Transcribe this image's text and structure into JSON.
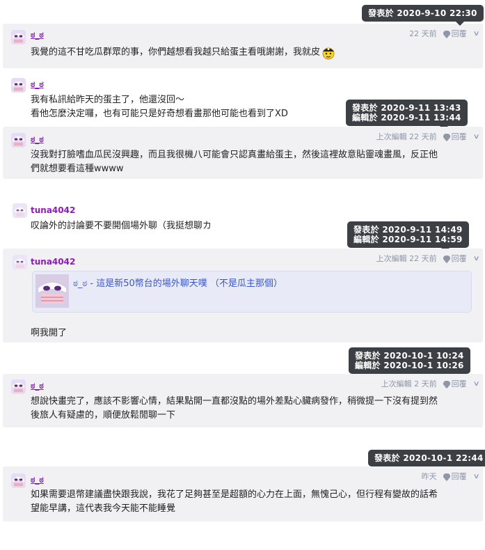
{
  "tooltips": [
    {
      "posted": "發表於 2020-9-10 22:30",
      "edited": ""
    },
    {
      "posted": "發表於 2020-9-11 13:43",
      "edited": "編輯於 2020-9-11 13:44"
    },
    {
      "posted": "發表於 2020-9-11 14:49",
      "edited": "編輯於 2020-9-11 14:59"
    },
    {
      "posted": "發表於 2020-10-1 10:24",
      "edited": "編輯於 2020-10-1 10:26"
    },
    {
      "posted": "發表於 2020-10-1 22:44",
      "edited": ""
    }
  ],
  "reply_label": "回覆",
  "icons": {
    "reply": "reply-bubble-icon",
    "more": "chevron-down-icon",
    "emoji": "pirate-emoji-icon"
  },
  "colors": {
    "username": "#8a1eb3",
    "meta": "#8e96a8",
    "tooltip_bg": "#3c3f44",
    "highlight_bg": "#f1f1f4",
    "embed_bg": "#e8ebf7",
    "embed_text": "#3a56c4"
  },
  "posts": [
    {
      "username": "ಠ_ಠ",
      "time": "22 天前",
      "lines": [
        "我覺的這不甘吃瓜群眾的事，你們越想看我越只給蛋主看哦謝謝，我就皮"
      ]
    },
    {
      "username": "ಠ_ಠ",
      "time": "",
      "lines": [
        "我有私訊給昨天的蛋主了，他還沒回～",
        "看他怎麼決定囉，也有可能只是好奇想看畫那他可能也看到了XD"
      ]
    },
    {
      "username": "ಠ_ಠ",
      "time": "上次編輯 22 天前",
      "lines": [
        "沒我對打臉嗜血瓜民沒興趣，而且我很機八可能會只認真畫給蛋主，然後這裡故意貼靈魂畫風，反正他",
        "們就想要看這種wwww"
      ]
    },
    {
      "username": "tuna4042",
      "time": "",
      "lines": [
        "叹論外的討論要不要開個場外聊（我挺想聊カ"
      ]
    },
    {
      "username": "tuna4042",
      "time": "上次編輯 22 天前",
      "embed": "ಠ_ಠ - 這是新50幣台的場外聊天噗 （不是瓜主那個）",
      "lines": [
        "啊我開了"
      ]
    },
    {
      "username": "ಠ_ಠ",
      "time": "上次編輯 2 天前",
      "lines": [
        "想說快畫完了，應該不影響心情，結果點開一直都沒點的場外差點心臟病發作，稍微提一下沒有提到然",
        "後旅人有疑慮的，順便放鬆閒聊一下"
      ]
    },
    {
      "username": "ಠ_ಠ",
      "time": "昨天",
      "lines": [
        "如果需要退幣建議盡快跟我說，我花了足夠甚至是超額的心力在上面，無愧己心，但行程有變故的話希",
        "望能早講，這代表我今天能不能睡覺"
      ]
    }
  ]
}
